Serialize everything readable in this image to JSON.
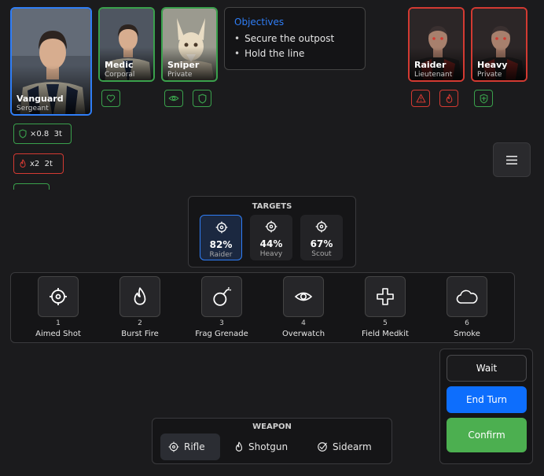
{
  "squad": [
    {
      "name": "Vanguard",
      "rank": "Sergeant"
    },
    {
      "name": "Medic",
      "rank": "Corporal"
    },
    {
      "name": "Sniper",
      "rank": "Private"
    }
  ],
  "enemies": [
    {
      "name": "Raider",
      "rank": "Lieutenant"
    },
    {
      "name": "Heavy",
      "rank": "Private"
    }
  ],
  "objectives": {
    "title": "Objectives",
    "items": [
      "Secure the outpost",
      "Hold the line"
    ]
  },
  "status_effects": [
    {
      "icon": "shield-icon",
      "label": "×0.8  3t"
    },
    {
      "icon": "flame-icon",
      "label": "x2  2t"
    }
  ],
  "targets": {
    "title": "TARGETS",
    "items": [
      {
        "pct": "82%",
        "name": "Raider",
        "selected": true
      },
      {
        "pct": "44%",
        "name": "Heavy"
      },
      {
        "pct": "67%",
        "name": "Scout"
      }
    ]
  },
  "abilities": [
    {
      "num": "1",
      "name": "Aimed Shot",
      "icon": "crosshair-icon"
    },
    {
      "num": "2",
      "name": "Burst Fire",
      "icon": "flame-icon"
    },
    {
      "num": "3",
      "name": "Frag Grenade",
      "icon": "bomb-icon"
    },
    {
      "num": "4",
      "name": "Overwatch",
      "icon": "eye-icon"
    },
    {
      "num": "5",
      "name": "Field Medkit",
      "icon": "medical-cross-icon"
    },
    {
      "num": "6",
      "name": "Smoke",
      "icon": "cloud-icon"
    }
  ],
  "weapon": {
    "title": "WEAPON",
    "options": [
      "Rifle",
      "Shotgun",
      "Sidearm"
    ],
    "selected": "Rifle"
  },
  "actions": {
    "wait": "Wait",
    "end_turn": "End Turn",
    "confirm": "Confirm"
  },
  "colors": {
    "ally": "#3aa14c",
    "selected": "#2f7ef7",
    "enemy": "#d33a32",
    "end_turn": "#0d6efd",
    "confirm": "#4caf50"
  }
}
